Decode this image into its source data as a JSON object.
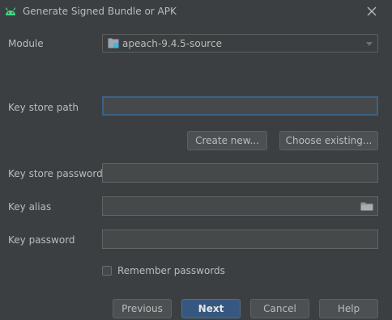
{
  "window": {
    "title": "Generate Signed Bundle or APK"
  },
  "form": {
    "module_label": "Module",
    "module_value": "apeach-9.4.5-source",
    "keystore_path_label": "Key store path",
    "keystore_path_value": "",
    "create_new_label": "Create new...",
    "choose_existing_label": "Choose existing...",
    "keystore_password_label": "Key store password",
    "keystore_password_value": "",
    "key_alias_label": "Key alias",
    "key_alias_value": "",
    "key_password_label": "Key password",
    "key_password_value": "",
    "remember_passwords_label": "Remember passwords",
    "remember_passwords_checked": false
  },
  "footer": {
    "previous_label": "Previous",
    "next_label": "Next",
    "cancel_label": "Cancel",
    "help_label": "Help"
  },
  "icons": {
    "app": "android-icon",
    "close": "close-icon",
    "module": "module-folder-icon",
    "dropdown": "chevron-down-icon",
    "browse": "folder-icon"
  },
  "colors": {
    "background": "#3c3f41",
    "field_background": "#45494a",
    "focus_border": "#3d6185",
    "primary_button": "#365880",
    "android_green": "#3ddc84",
    "text": "#bbbbbb"
  }
}
